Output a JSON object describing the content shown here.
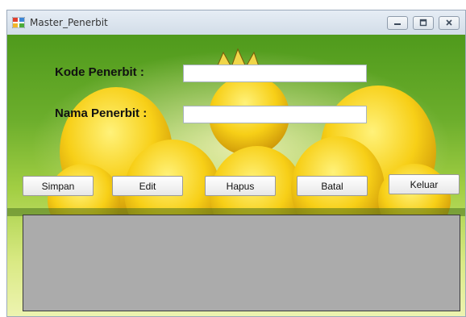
{
  "window": {
    "title": "Master_Penerbit",
    "controls": [
      "minimize-icon",
      "maximize-icon",
      "close-icon"
    ]
  },
  "form": {
    "kode_label": "Kode Penerbit :",
    "kode_value": "",
    "nama_label": "Nama Penerbit :",
    "nama_value": ""
  },
  "buttons": {
    "simpan": "Simpan",
    "edit": "Edit",
    "hapus": "Hapus",
    "batal": "Batal",
    "keluar": "Keluar"
  },
  "colors": {
    "grid_background": "#ababab",
    "background_green": "#6cae2c",
    "flower_yellow": "#f6cc14"
  }
}
